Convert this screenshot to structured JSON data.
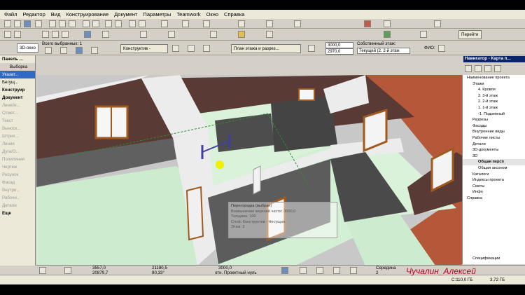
{
  "menu": [
    "Файл",
    "Редактор",
    "Вид",
    "Конструирование",
    "Документ",
    "Параметры",
    "Teamwork",
    "Окно",
    "Справка"
  ],
  "toolbar2": {
    "goto_label": "Перейти"
  },
  "toolbar3": {
    "window_tab": "3D-окно",
    "selected_label": "Всего выбранных: 1",
    "layer_label": "Собственный этаж:",
    "layer_value": "Текущий (2. 2-й этаж",
    "construction_btn": "Конструктив -",
    "plan_btn": "План этажа и разрез...",
    "height1": "3000,0",
    "height2": "2970,0",
    "fix_label": "ФИО:"
  },
  "left_panel": {
    "title": "Панель ...",
    "items": [
      "Выборка",
      "Указат...",
      "Бегущ...",
      "Конструир",
      "Документ",
      "Линейк...",
      "Отмет...",
      "Текст",
      "Выноск...",
      "Штрих...",
      "Линия",
      "Дуга/О...",
      "Полилиния",
      "Чертеж",
      "Рисунок",
      "Фасад",
      "Внутре...",
      "Рабочи...",
      "Детали",
      "Еще"
    ]
  },
  "navigator": {
    "title": "Навигатор - Карта п...",
    "items": [
      "Наименование проекта",
      "Этажи",
      "4. Кровля",
      "3. 3-й этаж",
      "2. 2-й этаж",
      "1. 1-й этаж",
      "-1. Подземный",
      "Разрезы",
      "Фасады",
      "Внутренние виды",
      "Рабочие листы",
      "Детали",
      "3D-документы",
      "3D",
      "Общая персп",
      "Общая аксоном",
      "Каталоги",
      "Индексы проекта",
      "Сметы",
      "Инфо",
      "Справка"
    ],
    "footer": "Спецификации"
  },
  "tooltip": {
    "lines": [
      "Перегородка (выбран)",
      "Возвышение верхней части: 3000,0",
      "Толщина: 100",
      "Слой: Конструктив - Несущая",
      "Этаж: 2"
    ]
  },
  "status": {
    "dx": "3557,0",
    "dy": "20879,7",
    "da": "21180,5",
    "angle": "80,33°",
    "dz": "3000,0",
    "ref": "отн. Проектный нуль",
    "mid_label": "Середина",
    "mid_value": "2"
  },
  "bottom": {
    "disk1": "С:110,0 ГБ",
    "disk2": "3,72 ГБ"
  },
  "signature": "Чучалин_Алексей"
}
